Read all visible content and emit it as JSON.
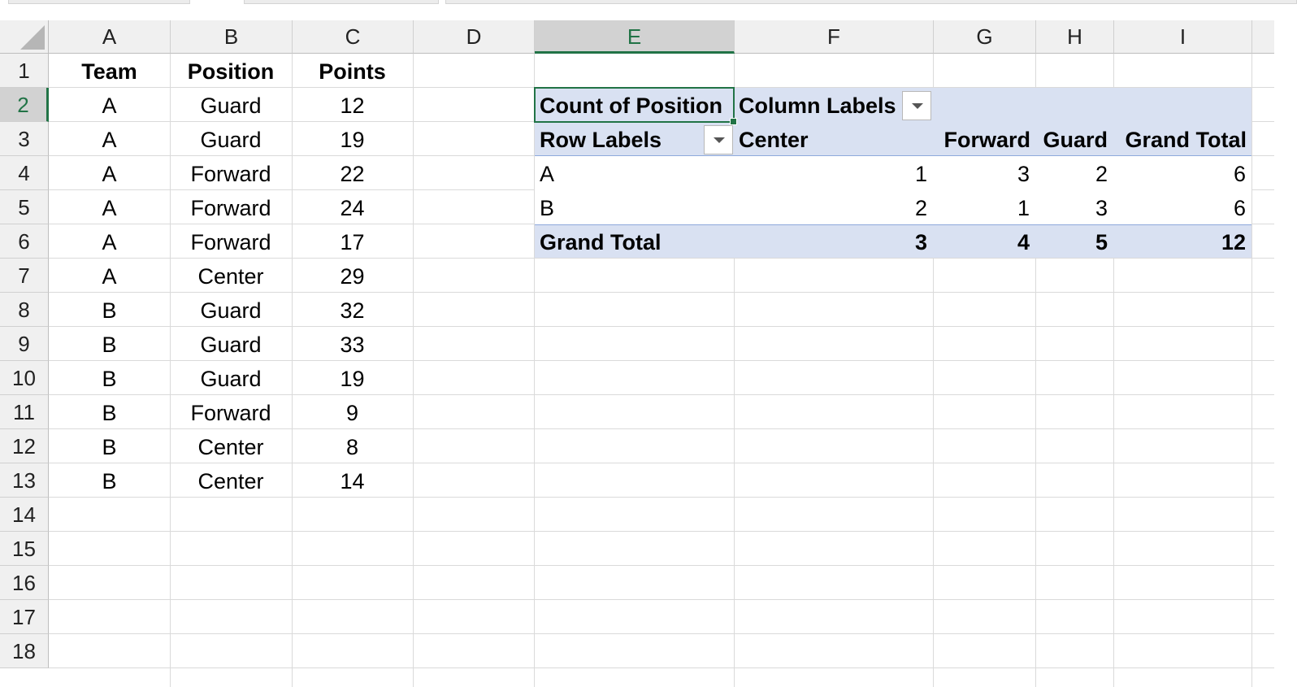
{
  "columns": [
    "A",
    "B",
    "C",
    "D",
    "E",
    "F",
    "G",
    "H",
    "I"
  ],
  "rows": [
    "1",
    "2",
    "3",
    "4",
    "5",
    "6",
    "7",
    "8",
    "9",
    "10",
    "11",
    "12",
    "13",
    "14",
    "15",
    "16",
    "17",
    "18"
  ],
  "selected_cell": "E2",
  "source_table": {
    "headers": [
      "Team",
      "Position",
      "Points"
    ],
    "rows": [
      [
        "A",
        "Guard",
        "12"
      ],
      [
        "A",
        "Guard",
        "19"
      ],
      [
        "A",
        "Forward",
        "22"
      ],
      [
        "A",
        "Forward",
        "24"
      ],
      [
        "A",
        "Forward",
        "17"
      ],
      [
        "A",
        "Center",
        "29"
      ],
      [
        "B",
        "Guard",
        "32"
      ],
      [
        "B",
        "Guard",
        "33"
      ],
      [
        "B",
        "Guard",
        "19"
      ],
      [
        "B",
        "Forward",
        "9"
      ],
      [
        "B",
        "Center",
        "8"
      ],
      [
        "B",
        "Center",
        "14"
      ]
    ]
  },
  "pivot": {
    "value_field": "Count of Position",
    "column_labels": "Column Labels",
    "row_labels": "Row Labels",
    "column_headers": [
      "Center",
      "Forward",
      "Guard",
      "Grand Total"
    ],
    "rows": [
      {
        "label": "A",
        "values": [
          "1",
          "3",
          "2",
          "6"
        ]
      },
      {
        "label": "B",
        "values": [
          "2",
          "1",
          "3",
          "6"
        ]
      }
    ],
    "grand_total": {
      "label": "Grand Total",
      "values": [
        "3",
        "4",
        "5",
        "12"
      ]
    }
  },
  "icons": {
    "corner": "select-all-triangle",
    "filter": "filter-dropdown-icon"
  },
  "colors": {
    "pivot_band": "#d9e1f2",
    "selection": "#217346",
    "header_bg": "#f0f0f0"
  }
}
